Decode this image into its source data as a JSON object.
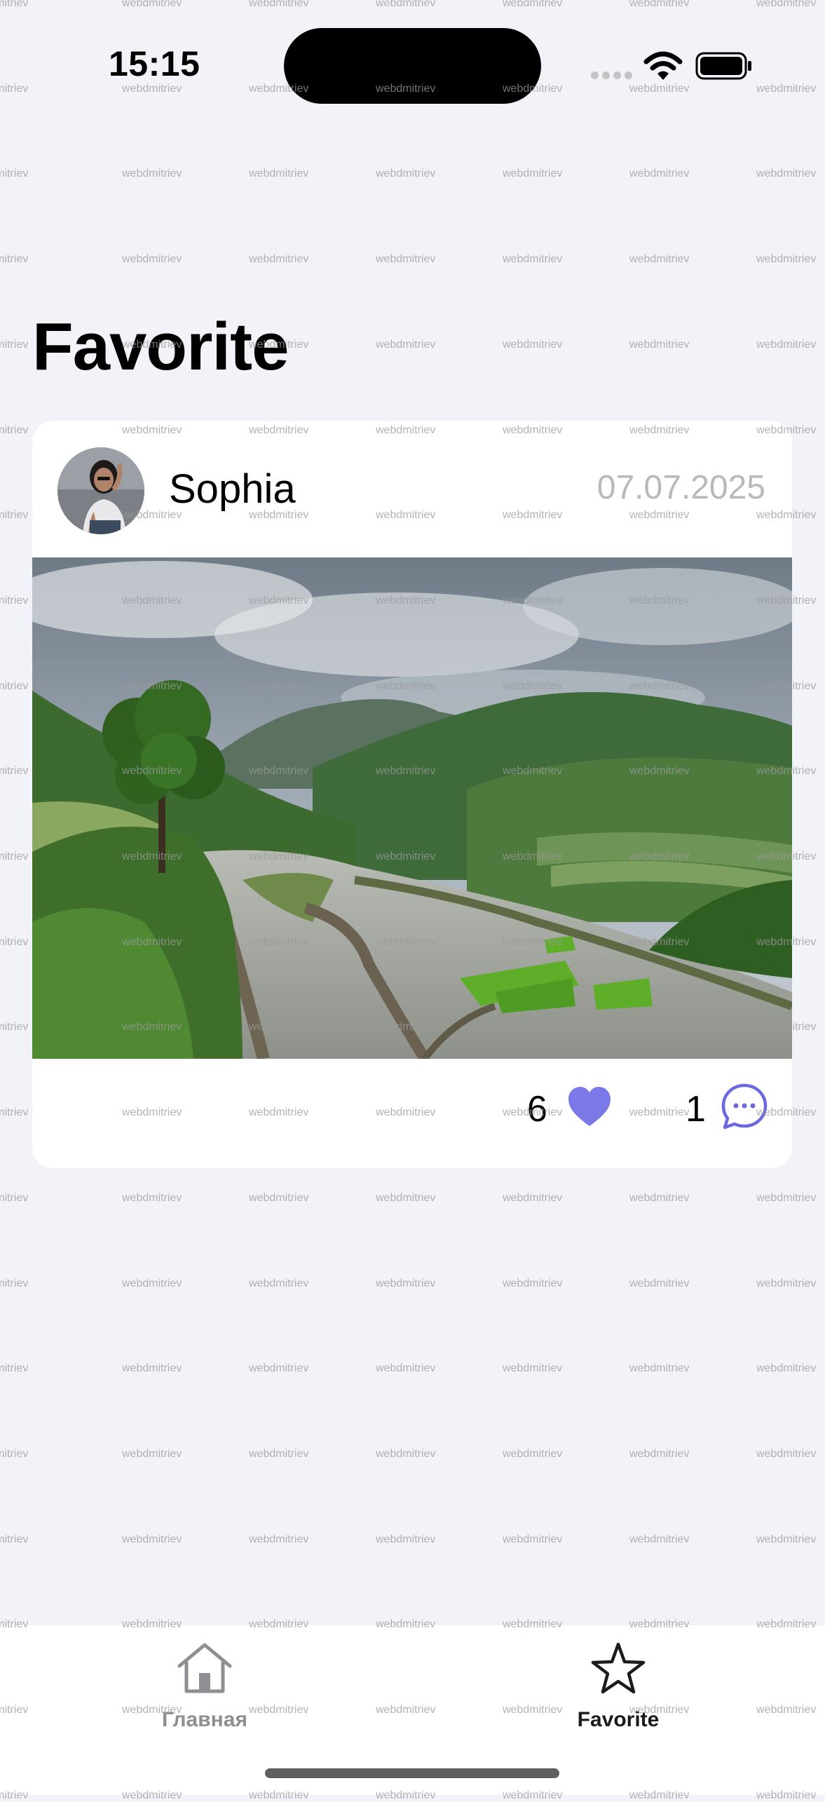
{
  "status_bar": {
    "time": "15:15"
  },
  "page": {
    "title": "Favorite"
  },
  "post": {
    "author": "Sophia",
    "date": "07.07.2025",
    "likes": "6",
    "comments": "1"
  },
  "tabs": [
    {
      "label": "Главная",
      "icon": "home-icon",
      "active": false
    },
    {
      "label": "Favorite",
      "icon": "star-icon",
      "active": true
    }
  ],
  "watermark": {
    "text": "webdmitriev"
  },
  "colors": {
    "background": "#f2f3f8",
    "accent": "#7b79e8",
    "inactive_tab": "#8e8e93"
  }
}
